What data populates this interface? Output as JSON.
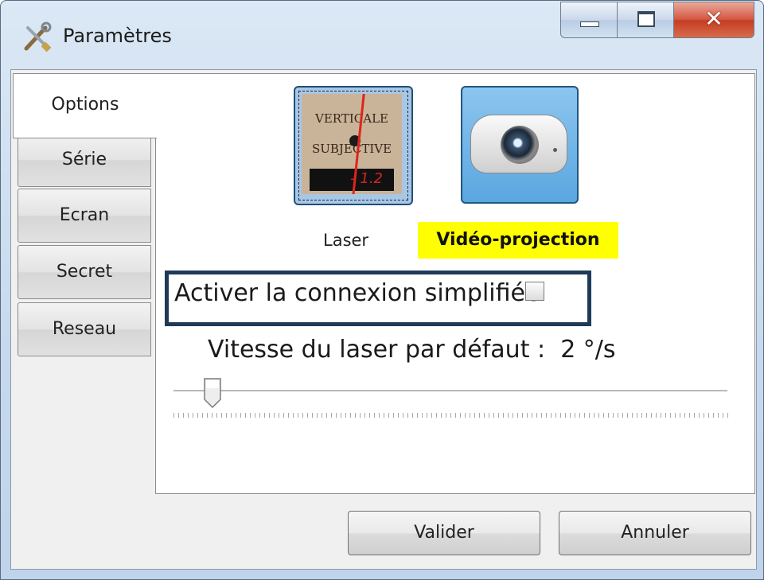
{
  "window": {
    "title": "Paramètres"
  },
  "tabs": {
    "active": "Options",
    "items": [
      "Série",
      "Ecran",
      "Secret",
      "Reseau"
    ]
  },
  "modes": {
    "laser_label": "Laser",
    "video_label": "Vidéo-projection",
    "selected": "Vidéo-projection",
    "laser_image_text": {
      "line1": "VERTICALE",
      "line2": "SUBJECTIVE",
      "display": "- 1.2"
    }
  },
  "simplified_connection": {
    "label": "Activer la connexion simplifiée",
    "checked": false
  },
  "laser_speed": {
    "label": "Vitesse du laser par défaut :",
    "value": "2 °/s",
    "slider_fraction": 0.07
  },
  "buttons": {
    "validate": "Valider",
    "cancel": "Annuler"
  },
  "colors": {
    "highlight_yellow": "#ffff00",
    "annotation_border": "#1f3a57",
    "close_button_red": "#c43c22"
  },
  "icons": [
    "settings-tools-icon",
    "minimize-icon",
    "maximize-icon",
    "close-icon",
    "projector-icon",
    "checkbox-unchecked-icon",
    "slider-thumb-icon"
  ]
}
